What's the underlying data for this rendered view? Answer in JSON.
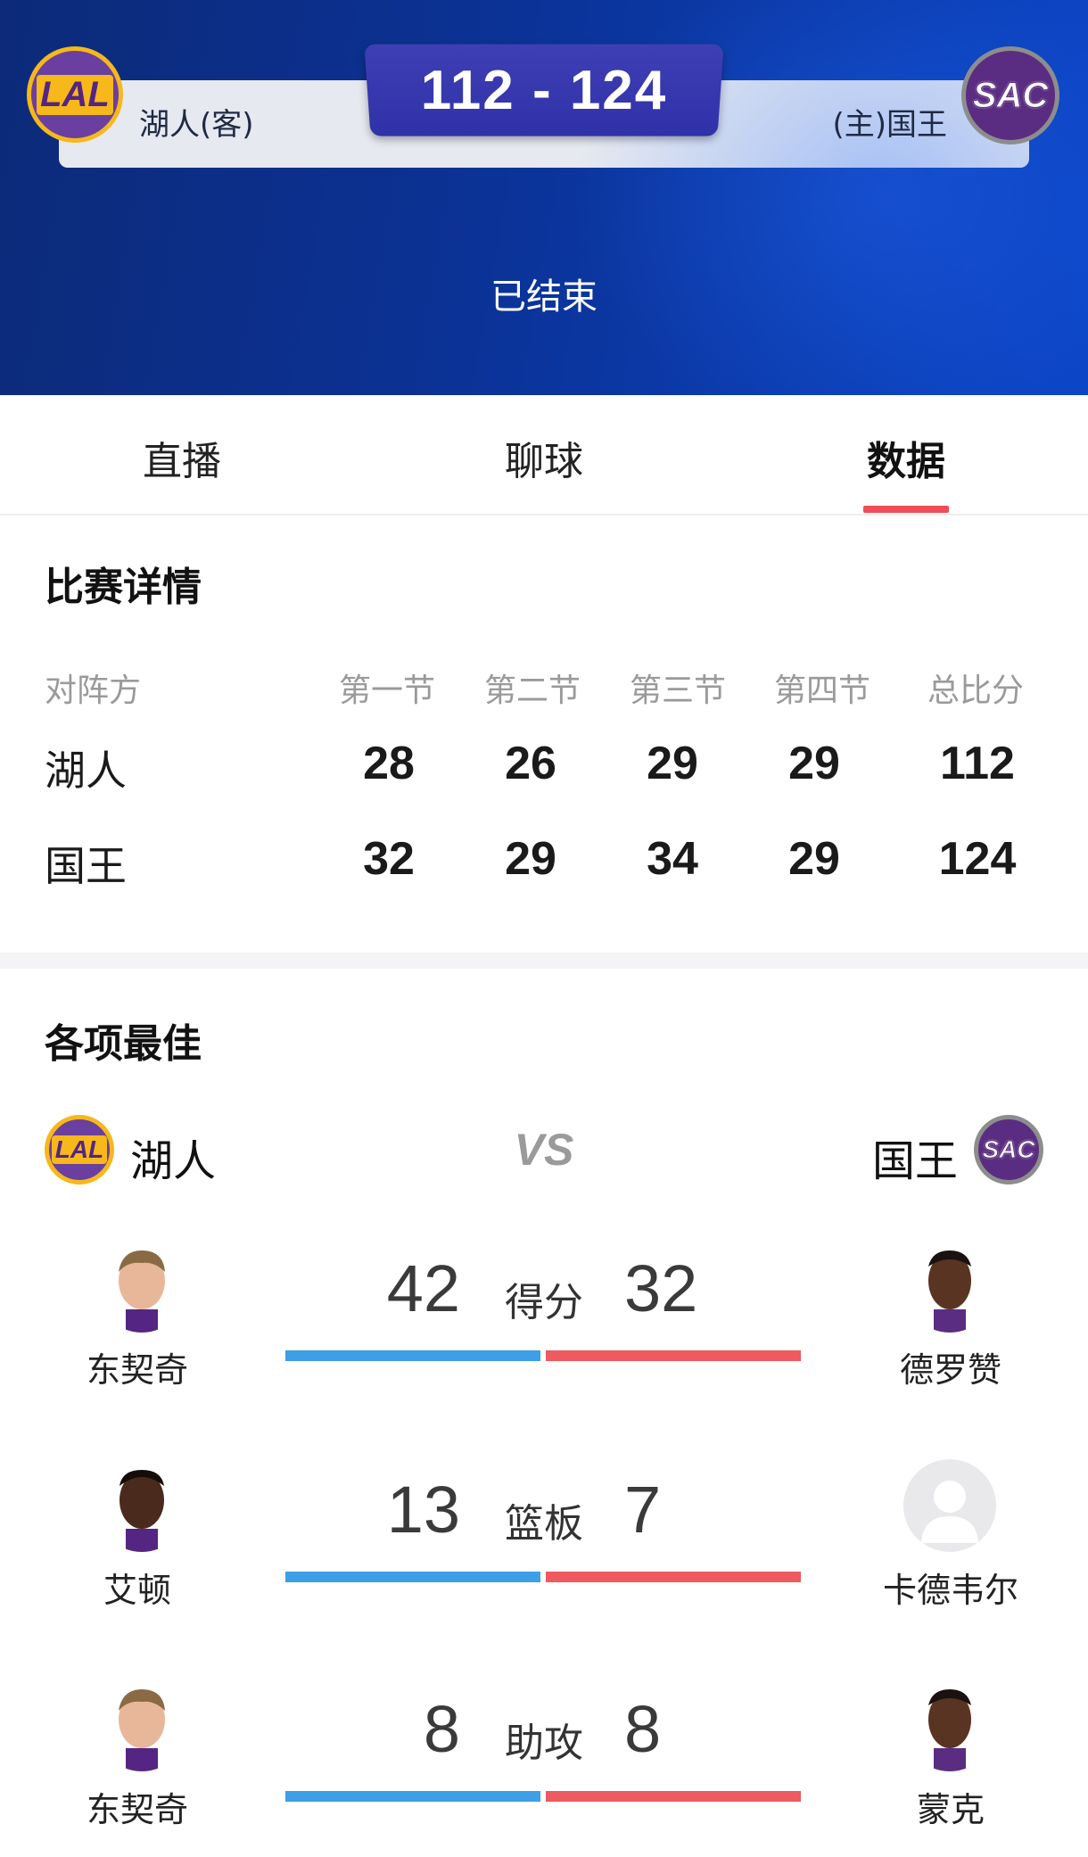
{
  "header": {
    "score": "112 - 124",
    "away_team": "湖人(客)",
    "home_team": "(主)国王",
    "away_logo_text": "LAL",
    "home_logo_text": "SAC",
    "status": "已结束"
  },
  "tabs": [
    {
      "label": "直播"
    },
    {
      "label": "聊球"
    },
    {
      "label": "数据",
      "active": true
    }
  ],
  "match_details": {
    "title": "比赛详情",
    "headers": [
      "对阵方",
      "第一节",
      "第二节",
      "第三节",
      "第四节",
      "总比分"
    ],
    "rows": [
      {
        "team": "湖人",
        "q1": "28",
        "q2": "26",
        "q3": "29",
        "q4": "29",
        "total": "112"
      },
      {
        "team": "国王",
        "q1": "32",
        "q2": "29",
        "q3": "34",
        "q4": "29",
        "total": "124"
      }
    ]
  },
  "leaders": {
    "title": "各项最佳",
    "left_team": "湖人",
    "right_team": "国王",
    "vs": "VS",
    "stats": [
      {
        "label": "得分",
        "left_value": "42",
        "right_value": "32",
        "left_player": "东契奇",
        "right_player": "德罗赞"
      },
      {
        "label": "篮板",
        "left_value": "13",
        "right_value": "7",
        "left_player": "艾顿",
        "right_player": "卡德韦尔"
      },
      {
        "label": "助攻",
        "left_value": "8",
        "right_value": "8",
        "left_player": "东契奇",
        "right_player": "蒙克"
      }
    ]
  },
  "colors": {
    "header_bg": "#0b3296",
    "score_box": "#3436aa",
    "accent_red": "#ef4d59",
    "bar_blue": "#3d9fe6",
    "bar_red": "#ef5a60",
    "lakers_purple": "#552583",
    "lakers_gold": "#f6b81a",
    "kings_purple": "#5a2d82"
  }
}
